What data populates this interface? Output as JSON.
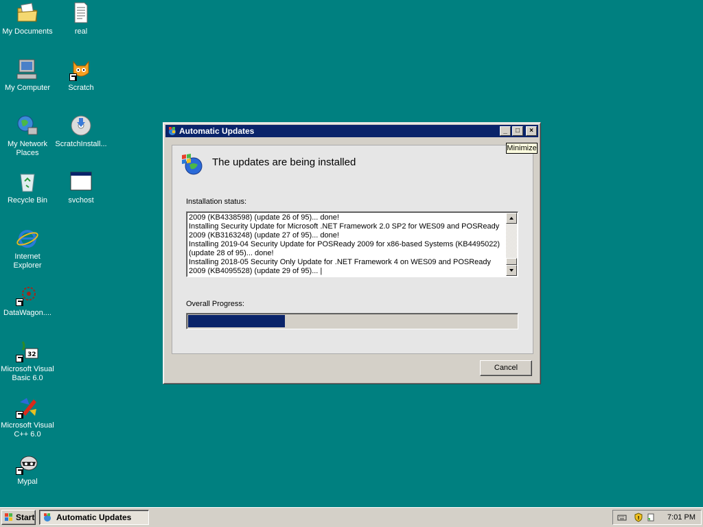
{
  "desktop": {
    "icons": [
      {
        "label": "My Documents"
      },
      {
        "label": "real"
      },
      {
        "label": "My Computer"
      },
      {
        "label": "Scratch"
      },
      {
        "label": "My Network Places"
      },
      {
        "label": "ScratchInstall..."
      },
      {
        "label": "Recycle Bin"
      },
      {
        "label": "svchost"
      },
      {
        "label": "Internet Explorer"
      },
      {
        "label": "DataWagon...."
      },
      {
        "label": "Microsoft Visual Basic 6.0"
      },
      {
        "label": "Microsoft Visual C++ 6.0"
      },
      {
        "label": "Mypal"
      }
    ]
  },
  "dialog": {
    "title": "Automatic Updates",
    "heading": "The updates are being installed",
    "status_label": "Installation status:",
    "log": "2009 (KB4338598) (update 26 of 95)... done!\nInstalling Security Update for Microsoft .NET Framework 2.0 SP2 for WES09 and POSReady 2009 (KB3163248) (update 27 of 95)... done!\nInstalling 2019-04 Security Update for POSReady 2009 for x86-based Systems (KB4495022) (update 28 of 95)... done!\nInstalling 2018-05 Security Only Update for .NET Framework 4 on WES09 and POSReady 2009 (KB4095528) (update 29 of 95)... |",
    "progress_label": "Overall Progress:",
    "progress_fraction": 0.295,
    "cancel_label": "Cancel",
    "buttons": {
      "minimize": "_",
      "maximize": "□",
      "close": "×"
    }
  },
  "tooltip": "Minimize",
  "taskbar": {
    "start_label": "Start",
    "task_label": "Automatic Updates",
    "clock": "7:01 PM"
  },
  "colors": {
    "desktop": "#008080",
    "titlebar": "#0a246a",
    "progress": "#0a246a"
  }
}
